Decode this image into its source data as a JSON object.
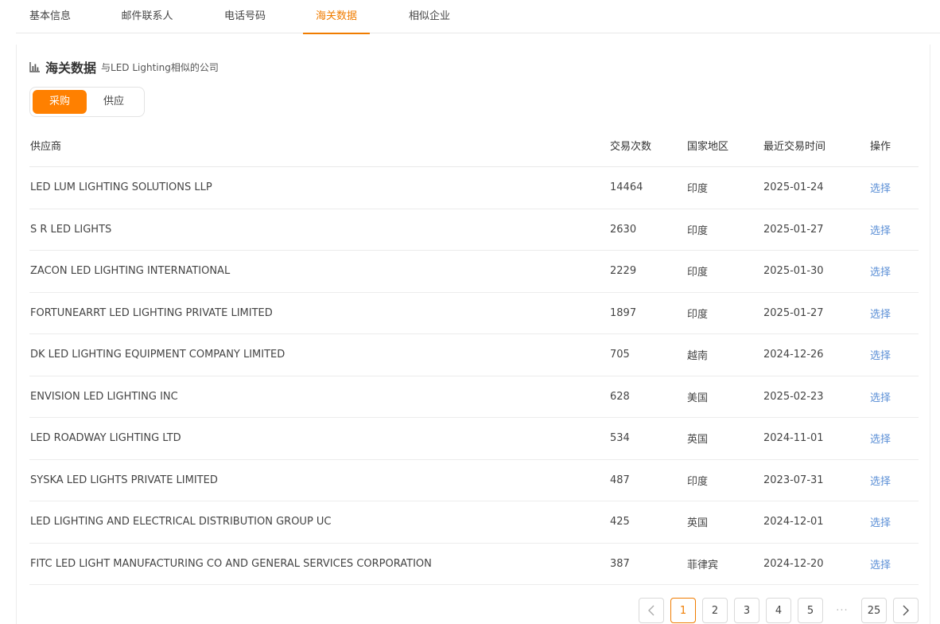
{
  "tabs": [
    {
      "label": "基本信息"
    },
    {
      "label": "邮件联系人"
    },
    {
      "label": "电话号码"
    },
    {
      "label": "海关数据"
    },
    {
      "label": "相似企业"
    }
  ],
  "section": {
    "title": "海关数据",
    "subtitle": "与LED Lighting相似的公司",
    "icon": "bar-chart-icon"
  },
  "toggle": {
    "buy": "采购",
    "supply": "供应",
    "active": "采购"
  },
  "table": {
    "headers": {
      "supplier": "供应商",
      "count": "交易次数",
      "country": "国家地区",
      "date": "最近交易时间",
      "op": "操作"
    },
    "rows": [
      {
        "supplier": "LED LUM LIGHTING SOLUTIONS LLP",
        "count": "14464",
        "country": "印度",
        "date": "2025-01-24",
        "op": "选择"
      },
      {
        "supplier": "S R LED LIGHTS",
        "count": "2630",
        "country": "印度",
        "date": "2025-01-27",
        "op": "选择"
      },
      {
        "supplier": "ZACON LED LIGHTING INTERNATIONAL",
        "count": "2229",
        "country": "印度",
        "date": "2025-01-30",
        "op": "选择"
      },
      {
        "supplier": "FORTUNEARRT LED LIGHTING PRIVATE LIMITED",
        "count": "1897",
        "country": "印度",
        "date": "2025-01-27",
        "op": "选择"
      },
      {
        "supplier": "DK LED LIGHTING EQUIPMENT COMPANY LIMITED",
        "count": "705",
        "country": "越南",
        "date": "2024-12-26",
        "op": "选择"
      },
      {
        "supplier": "ENVISION LED LIGHTING INC",
        "count": "628",
        "country": "美国",
        "date": "2025-02-23",
        "op": "选择"
      },
      {
        "supplier": "LED ROADWAY LIGHTING LTD",
        "count": "534",
        "country": "英国",
        "date": "2024-11-01",
        "op": "选择"
      },
      {
        "supplier": "SYSKA LED LIGHTS PRIVATE LIMITED",
        "count": "487",
        "country": "印度",
        "date": "2023-07-31",
        "op": "选择"
      },
      {
        "supplier": "LED LIGHTING AND ELECTRICAL DISTRIBUTION GROUP UC",
        "count": "425",
        "country": "英国",
        "date": "2024-12-01",
        "op": "选择"
      },
      {
        "supplier": "FITC LED LIGHT MANUFACTURING CO AND GENERAL SERVICES CORPORATION",
        "count": "387",
        "country": "菲律宾",
        "date": "2024-12-20",
        "op": "选择"
      }
    ]
  },
  "pagination": {
    "pages": [
      "1",
      "2",
      "3",
      "4",
      "5"
    ],
    "ellipsis": "···",
    "last": "25",
    "current": "1"
  },
  "colors": {
    "accent": "#ff8000",
    "link": "#5b8fd6"
  }
}
